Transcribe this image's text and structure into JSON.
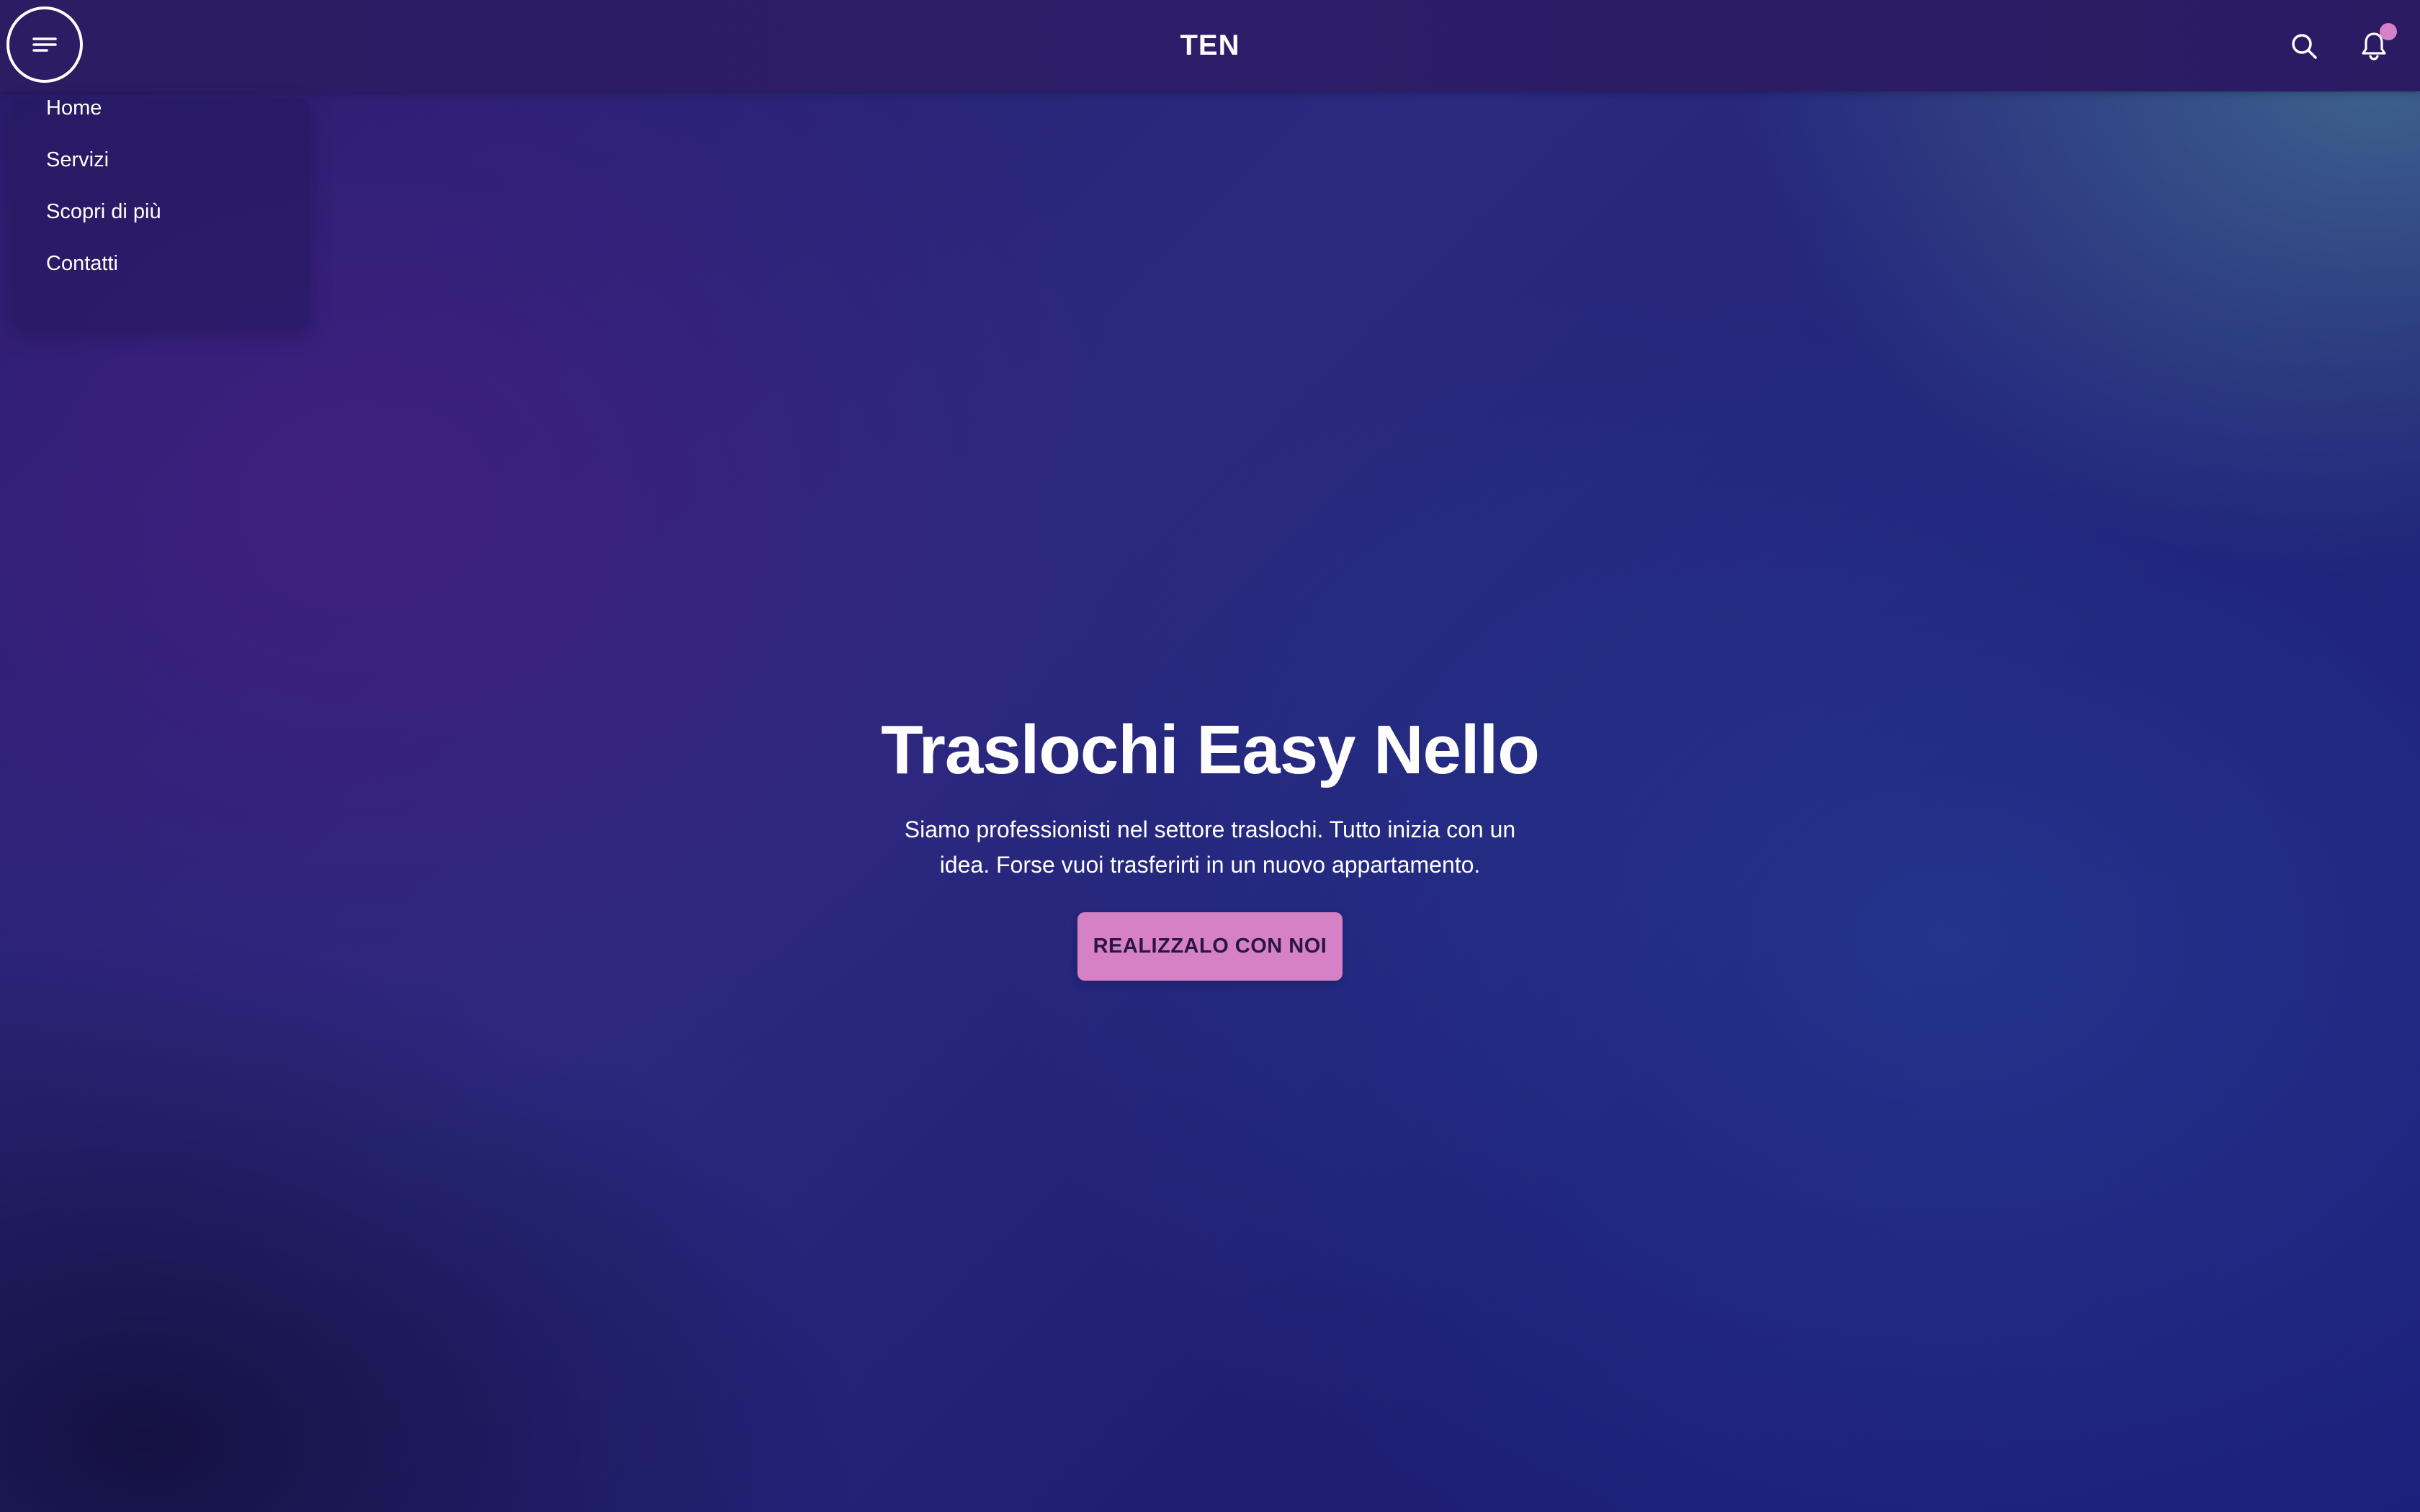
{
  "header": {
    "brand": "TEN",
    "menu_icon": "menu-icon",
    "search_icon": "search-icon",
    "notification_icon": "bell-icon",
    "notification_dot_color": "#d77fc7"
  },
  "menu": {
    "items": [
      {
        "label": "Home"
      },
      {
        "label": "Servizi"
      },
      {
        "label": "Scopri di più"
      },
      {
        "label": "Contatti"
      }
    ]
  },
  "hero": {
    "title": "Traslochi Easy Nello",
    "subtitle": "Siamo professionisti nel settore traslochi. Tutto inizia con un idea. Forse vuoi trasferirti in un nuovo appartamento.",
    "cta_label": "REALIZZALO CON NOI"
  },
  "colors": {
    "accent": "#d680c6",
    "header_bg": "#2b1c63"
  }
}
